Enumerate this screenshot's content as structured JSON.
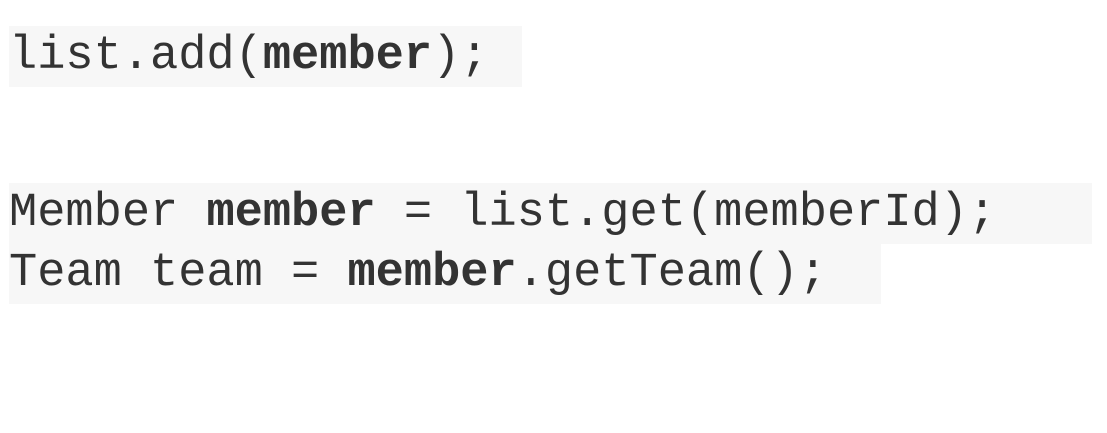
{
  "code_blocks": [
    {
      "lines": [
        {
          "segments": [
            {
              "text": "list.add(",
              "bold": false
            },
            {
              "text": "member",
              "bold": true
            },
            {
              "text": ");",
              "bold": false
            }
          ]
        }
      ]
    },
    {
      "lines": [
        {
          "segments": [
            {
              "text": "Member ",
              "bold": false
            },
            {
              "text": "member",
              "bold": true
            },
            {
              "text": " = list.get(memberId);",
              "bold": false
            }
          ]
        },
        {
          "segments": [
            {
              "text": "Team team = ",
              "bold": false
            },
            {
              "text": "member",
              "bold": true
            },
            {
              "text": ".getTeam();",
              "bold": false
            }
          ]
        }
      ]
    }
  ],
  "colors": {
    "text": "#333333",
    "code_background": "#f7f7f7",
    "page_background": "#ffffff"
  }
}
